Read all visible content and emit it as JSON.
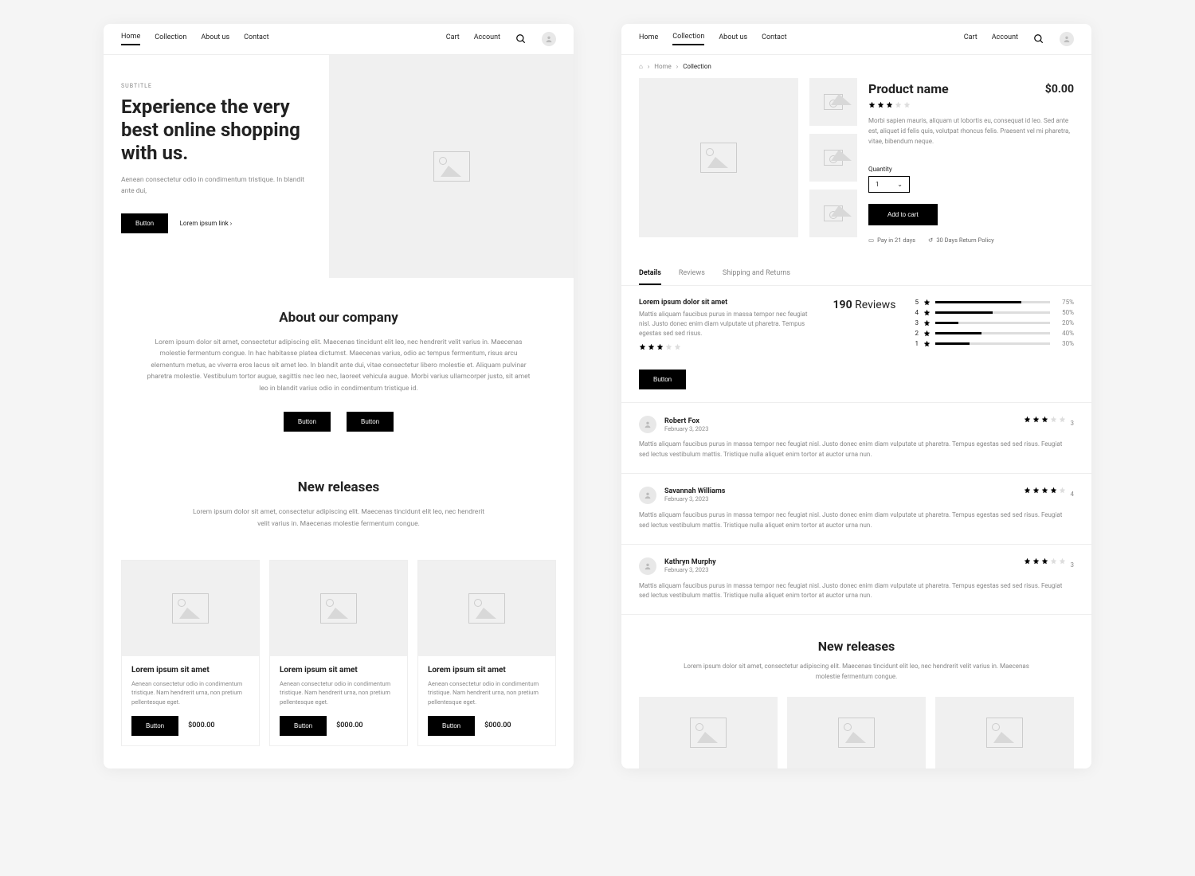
{
  "nav": {
    "items": [
      "Home",
      "Collection",
      "About us",
      "Contact"
    ],
    "cart": "Cart",
    "account": "Account"
  },
  "hero": {
    "subtitle": "SUBTITLE",
    "title": "Experience the very best online shopping with us.",
    "desc": "Aenean consectetur odio in condimentum tristique. In blandit ante dui,",
    "button": "Button",
    "link": "Lorem ipsum link"
  },
  "about": {
    "title": "About our company",
    "desc": "Lorem ipsum dolor sit amet, consectetur adipiscing elit. Maecenas tincidunt elit leo, nec hendrerit velit varius in. Maecenas molestie fermentum congue. In hac habitasse platea dictumst. Maecenas varius, odio ac tempus fermentum, risus arcu elementum metus, ac viverra eros lacus sit amet leo. In blandit ante dui, vitae consectetur libero molestie et. Aliquam pulvinar pharetra molestie. Vestibulum tortor augue, sagittis nec leo nec, laoreet vehicula augue. Morbi varius ullamcorper justo, sit amet leo in blandit varius odio in condimentum tristique id.",
    "btn1": "Button",
    "btn2": "Button"
  },
  "releases": {
    "title": "New releases",
    "desc": "Lorem ipsum dolor sit amet, consectetur adipiscing elit. Maecenas tincidunt elit leo, nec hendrerit velit varius in. Maecenas molestie fermentum congue.",
    "cards": [
      {
        "title": "Lorem ipsum sit amet",
        "desc": "Aenean consectetur odio in condimentum tristique. Nam hendrerit urna, non pretium pellentesque eget.",
        "btn": "Button",
        "price": "$000.00"
      },
      {
        "title": "Lorem ipsum sit amet",
        "desc": "Aenean consectetur odio in condimentum tristique. Nam hendrerit urna, non pretium pellentesque eget.",
        "btn": "Button",
        "price": "$000.00"
      },
      {
        "title": "Lorem ipsum sit amet",
        "desc": "Aenean consectetur odio in condimentum tristique. Nam hendrerit urna, non pretium pellentesque eget.",
        "btn": "Button",
        "price": "$000.00"
      }
    ]
  },
  "pdp": {
    "breadcrumb": {
      "home": "Home",
      "collection": "Collection"
    },
    "title": "Product name",
    "price": "$0.00",
    "rating": 3,
    "desc": "Morbi sapien mauris, aliquam ut lobortis eu, consequat id leo. Sed ante est, aliquet id felis quis, volutpat rhoncus felis. Praesent vel mi pharetra, vitae, bibendum neque.",
    "qty_label": "Quantity",
    "qty_value": "1",
    "add_to_cart": "Add to cart",
    "policy1": "Pay in 21 days",
    "policy2": "30 Days Return Policy"
  },
  "tabs": [
    "Details",
    "Reviews",
    "Shipping and Returns"
  ],
  "details": {
    "heading": "Lorem ipsum dolor sit amet",
    "text": "Mattis aliquam faucibus purus in massa tempor nec feugiat nisl. Justo donec enim diam vulputate ut pharetra. Tempus egestas sed sed risus.",
    "button": "Button",
    "review_count": "190",
    "review_label": "Reviews",
    "rating": 3,
    "bars": [
      {
        "star": "5",
        "pct": 75
      },
      {
        "star": "4",
        "pct": 50
      },
      {
        "star": "3",
        "pct": 20
      },
      {
        "star": "2",
        "pct": 40
      },
      {
        "star": "1",
        "pct": 30
      }
    ]
  },
  "reviews": [
    {
      "name": "Robert Fox",
      "date": "February 3, 2023",
      "rating": 3,
      "text": "Mattis aliquam faucibus purus in massa tempor nec feugiat nisl. Justo donec enim diam vulputate ut pharetra. Tempus egestas sed sed risus. Feugiat sed lectus vestibulum mattis. Tristique nulla aliquet enim tortor at auctor urna nun."
    },
    {
      "name": "Savannah Williams",
      "date": "February 3, 2023",
      "rating": 4,
      "text": "Mattis aliquam faucibus purus in massa tempor nec feugiat nisl. Justo donec enim diam vulputate ut pharetra. Tempus egestas sed sed risus. Feugiat sed lectus vestibulum mattis. Tristique nulla aliquet enim tortor at auctor urna nun."
    },
    {
      "name": "Kathryn Murphy",
      "date": "February 3, 2023",
      "rating": 3,
      "text": "Mattis aliquam faucibus purus in massa tempor nec feugiat nisl. Justo donec enim diam vulputate ut pharetra. Tempus egestas sed sed risus. Feugiat sed lectus vestibulum mattis. Tristique nulla aliquet enim tortor at auctor urna nun."
    }
  ],
  "new2": {
    "title": "New releases",
    "desc": "Lorem ipsum dolor sit amet, consectetur adipiscing elit. Maecenas tincidunt elit leo, nec hendrerit velit varius in. Maecenas molestie fermentum congue."
  }
}
